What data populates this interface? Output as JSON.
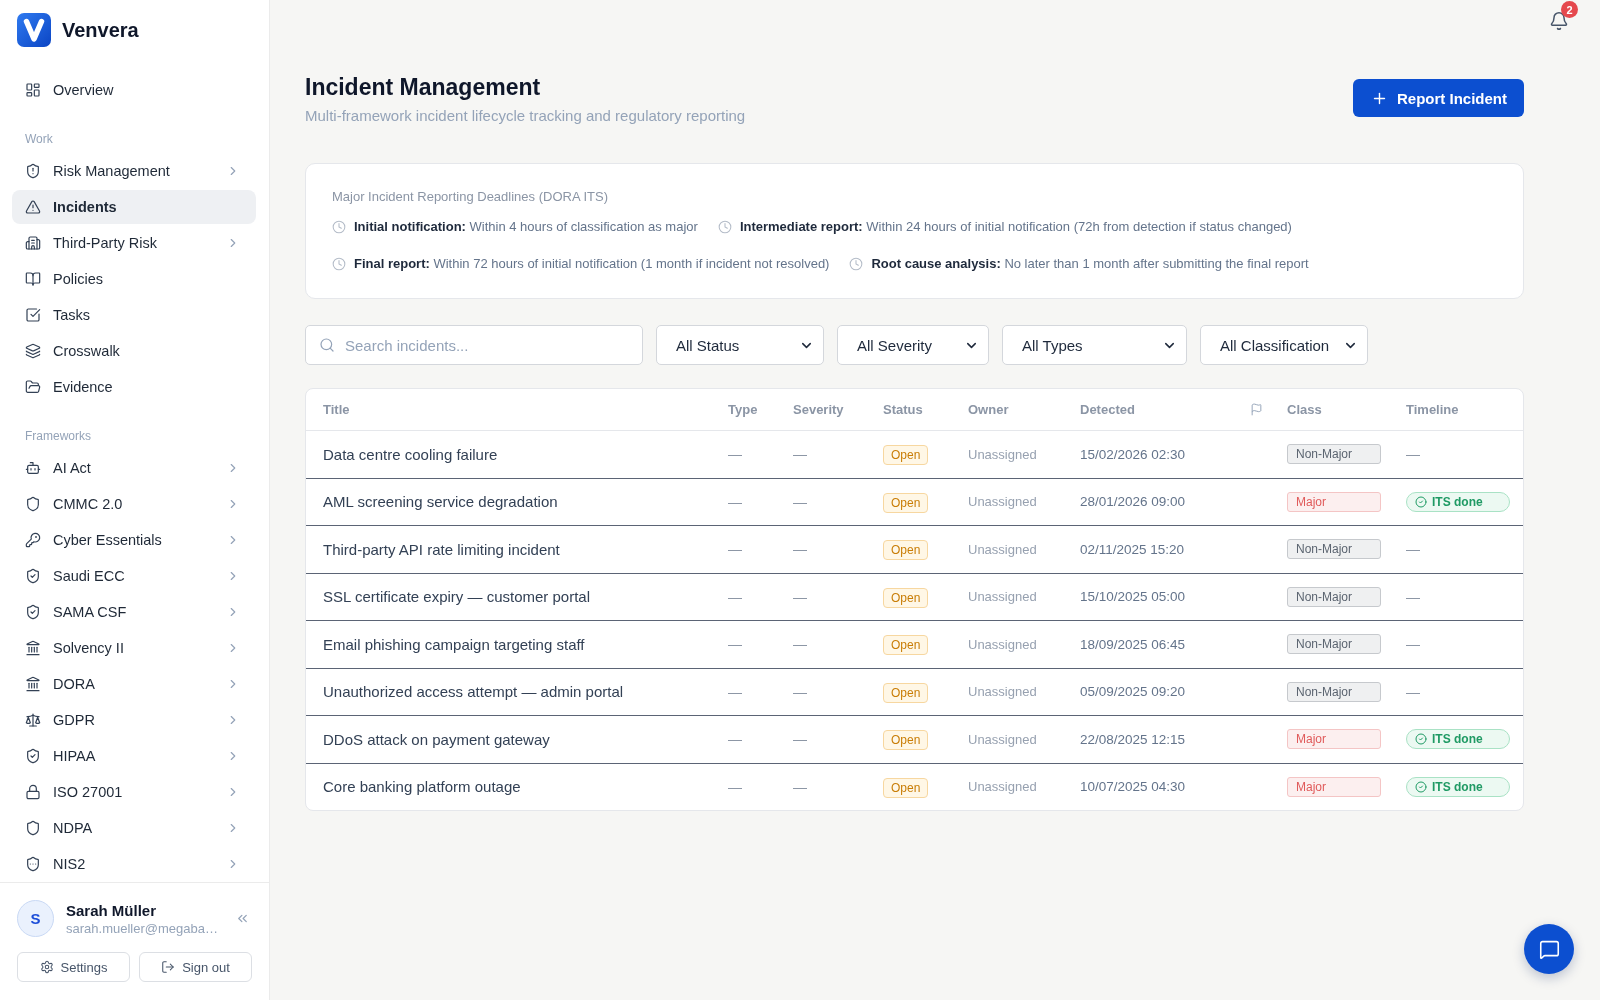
{
  "brand": {
    "name": "Venvera"
  },
  "notifications": {
    "count": "2"
  },
  "sidebar": {
    "sections": [
      {
        "items": [
          {
            "label": "Overview",
            "selected": false,
            "expandable": false
          }
        ]
      },
      {
        "heading": "Work",
        "items": [
          {
            "label": "Risk Management",
            "selected": false,
            "expandable": true
          },
          {
            "label": "Incidents",
            "selected": true,
            "expandable": false
          },
          {
            "label": "Third-Party Risk",
            "selected": false,
            "expandable": true
          },
          {
            "label": "Policies",
            "selected": false,
            "expandable": false
          },
          {
            "label": "Tasks",
            "selected": false,
            "expandable": false
          },
          {
            "label": "Crosswalk",
            "selected": false,
            "expandable": false
          },
          {
            "label": "Evidence",
            "selected": false,
            "expandable": false
          }
        ]
      },
      {
        "heading": "Frameworks",
        "items": [
          {
            "label": "AI Act",
            "selected": false,
            "expandable": true
          },
          {
            "label": "CMMC 2.0",
            "selected": false,
            "expandable": true
          },
          {
            "label": "Cyber Essentials",
            "selected": false,
            "expandable": true
          },
          {
            "label": "Saudi ECC",
            "selected": false,
            "expandable": true
          },
          {
            "label": "SAMA CSF",
            "selected": false,
            "expandable": true
          },
          {
            "label": "Solvency II",
            "selected": false,
            "expandable": true
          },
          {
            "label": "DORA",
            "selected": false,
            "expandable": true
          },
          {
            "label": "GDPR",
            "selected": false,
            "expandable": true
          },
          {
            "label": "HIPAA",
            "selected": false,
            "expandable": true
          },
          {
            "label": "ISO 27001",
            "selected": false,
            "expandable": true
          },
          {
            "label": "NDPA",
            "selected": false,
            "expandable": true
          },
          {
            "label": "NIS2",
            "selected": false,
            "expandable": true
          }
        ]
      }
    ],
    "user": {
      "initial": "S",
      "name": "Sarah Müller",
      "email": "sarah.mueller@megaba…"
    },
    "footer_buttons": [
      {
        "label": "Settings",
        "kind": "settings"
      },
      {
        "label": "Sign out",
        "kind": "sign-out"
      }
    ]
  },
  "page": {
    "title": "Incident Management",
    "subtitle": "Multi-framework incident lifecycle tracking and regulatory reporting",
    "primary_action": {
      "label": "Report Incident"
    }
  },
  "deadlines": {
    "heading": "Major Incident Reporting Deadlines (DORA ITS)",
    "items": [
      "**Initial notification:** Within 4 hours of classification as major",
      "**Intermediate report:** Within 24 hours of initial notification (72h from detection if status changed)",
      "**Final report:** Within 72 hours of initial notification (1 month if incident not resolved)",
      "**Root cause analysis:** No later than 1 month after submitting the final report"
    ]
  },
  "filters": {
    "search": {
      "placeholder": "Search incidents..."
    },
    "selects": [
      "All Status",
      "All Severity",
      "All Types",
      "All Classification"
    ]
  },
  "table": {
    "columns": [
      {
        "kind": "text",
        "label": "Title"
      },
      {
        "kind": "text",
        "label": "Type"
      },
      {
        "kind": "text",
        "label": "Severity"
      },
      {
        "kind": "text",
        "label": "Status"
      },
      {
        "kind": "text",
        "label": "Owner"
      },
      {
        "kind": "text",
        "label": "Detected"
      },
      {
        "kind": "icon"
      },
      {
        "kind": "text",
        "label": "Class"
      },
      {
        "kind": "text",
        "label": "Timeline"
      }
    ],
    "rows": [
      {
        "title": "Data centre cooling failure",
        "type": "—",
        "severity": "—",
        "status": "Open",
        "owner": "Unassigned",
        "detected": "15/02/2026 02:30",
        "class": {
          "label": "Non-Major",
          "color": "#5b6470"
        },
        "timeline": {
          "kind": "text",
          "label": "—"
        }
      },
      {
        "title": "AML screening service degradation",
        "type": "—",
        "severity": "—",
        "status": "Open",
        "owner": "Unassigned",
        "detected": "28/01/2026 09:00",
        "class": {
          "label": "Major",
          "color": "#e05a5a"
        },
        "timeline": {
          "kind": "badge",
          "label": "ITS done"
        }
      },
      {
        "title": "Third-party API rate limiting incident",
        "type": "—",
        "severity": "—",
        "status": "Open",
        "owner": "Unassigned",
        "detected": "02/11/2025 15:20",
        "class": {
          "label": "Non-Major",
          "color": "#5b6470"
        },
        "timeline": {
          "kind": "text",
          "label": "—"
        }
      },
      {
        "title": "SSL certificate expiry — customer portal",
        "type": "—",
        "severity": "—",
        "status": "Open",
        "owner": "Unassigned",
        "detected": "15/10/2025 05:00",
        "class": {
          "label": "Non-Major",
          "color": "#5b6470"
        },
        "timeline": {
          "kind": "text",
          "label": "—"
        }
      },
      {
        "title": "Email phishing campaign targeting staff",
        "type": "—",
        "severity": "—",
        "status": "Open",
        "owner": "Unassigned",
        "detected": "18/09/2025 06:45",
        "class": {
          "label": "Non-Major",
          "color": "#5b6470"
        },
        "timeline": {
          "kind": "text",
          "label": "—"
        }
      },
      {
        "title": "Unauthorized access attempt — admin portal",
        "type": "—",
        "severity": "—",
        "status": "Open",
        "owner": "Unassigned",
        "detected": "05/09/2025 09:20",
        "class": {
          "label": "Non-Major",
          "color": "#5b6470"
        },
        "timeline": {
          "kind": "text",
          "label": "—"
        }
      },
      {
        "title": "DDoS attack on payment gateway",
        "type": "—",
        "severity": "—",
        "status": "Open",
        "owner": "Unassigned",
        "detected": "22/08/2025 12:15",
        "class": {
          "label": "Major",
          "color": "#e05a5a"
        },
        "timeline": {
          "kind": "badge",
          "label": "ITS done"
        }
      },
      {
        "title": "Core banking platform outage",
        "type": "—",
        "severity": "—",
        "status": "Open",
        "owner": "Unassigned",
        "detected": "10/07/2025 04:30",
        "class": {
          "label": "Major",
          "color": "#e05a5a"
        },
        "timeline": {
          "kind": "badge",
          "label": "ITS done"
        }
      }
    ]
  }
}
